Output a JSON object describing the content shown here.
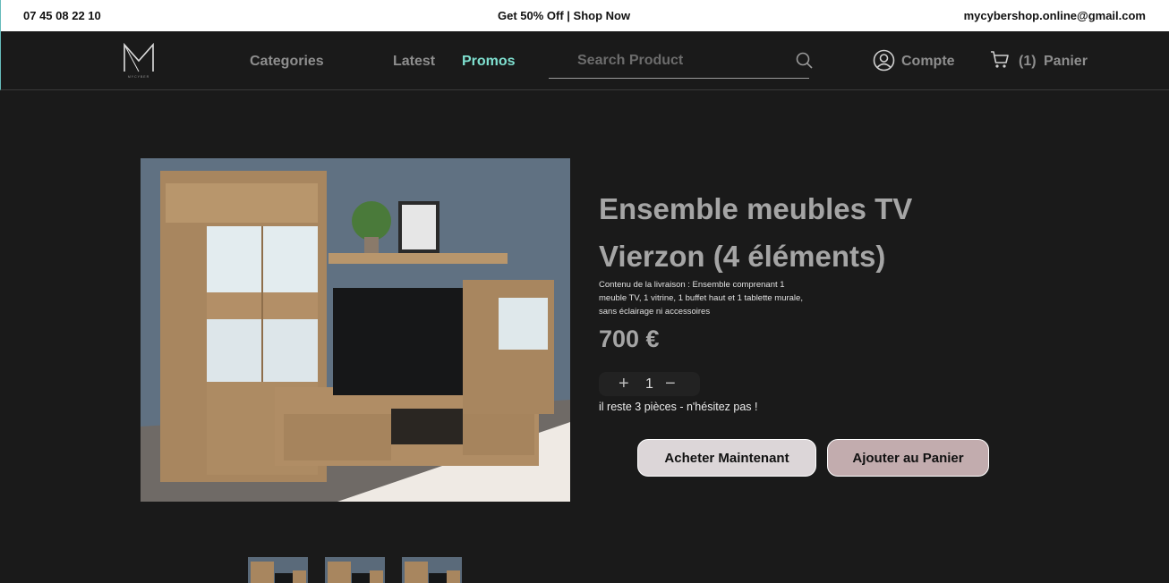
{
  "topbar": {
    "phone": "07 45 08 22 10",
    "promo": "Get 50% Off | Shop Now",
    "email": "mycybershop.online@gmail.com"
  },
  "nav": {
    "logo_text": "MYCYBER",
    "categories": "Categories",
    "latest": "Latest",
    "promos": "Promos",
    "search_placeholder": "Search Product",
    "account": "Compte",
    "cart_count": "(1)",
    "cart": "Panier",
    "promos_color": "#7fe0d0"
  },
  "product": {
    "title": "Ensemble meubles TV Vierzon (4 éléments)",
    "description": "Contenu de la livraison : Ensemble comprenant 1 meuble TV, 1 vitrine, 1 buffet haut et 1 tablette murale, sans éclairage ni accessoires",
    "price": "700 €",
    "quantity": "1",
    "qty_plus": "+",
    "qty_minus": "−",
    "stock": "il reste 3 pièces - n'hésitez pas !",
    "buy_now": "Acheter Maintenant",
    "add_to_cart": "Ajouter au Panier",
    "thumbnails": 3
  },
  "colors": {
    "background": "#1a1a1a",
    "accent": "#7fe0d0",
    "buy_button": "#dcd6d8",
    "cart_button": "#c2acae"
  }
}
